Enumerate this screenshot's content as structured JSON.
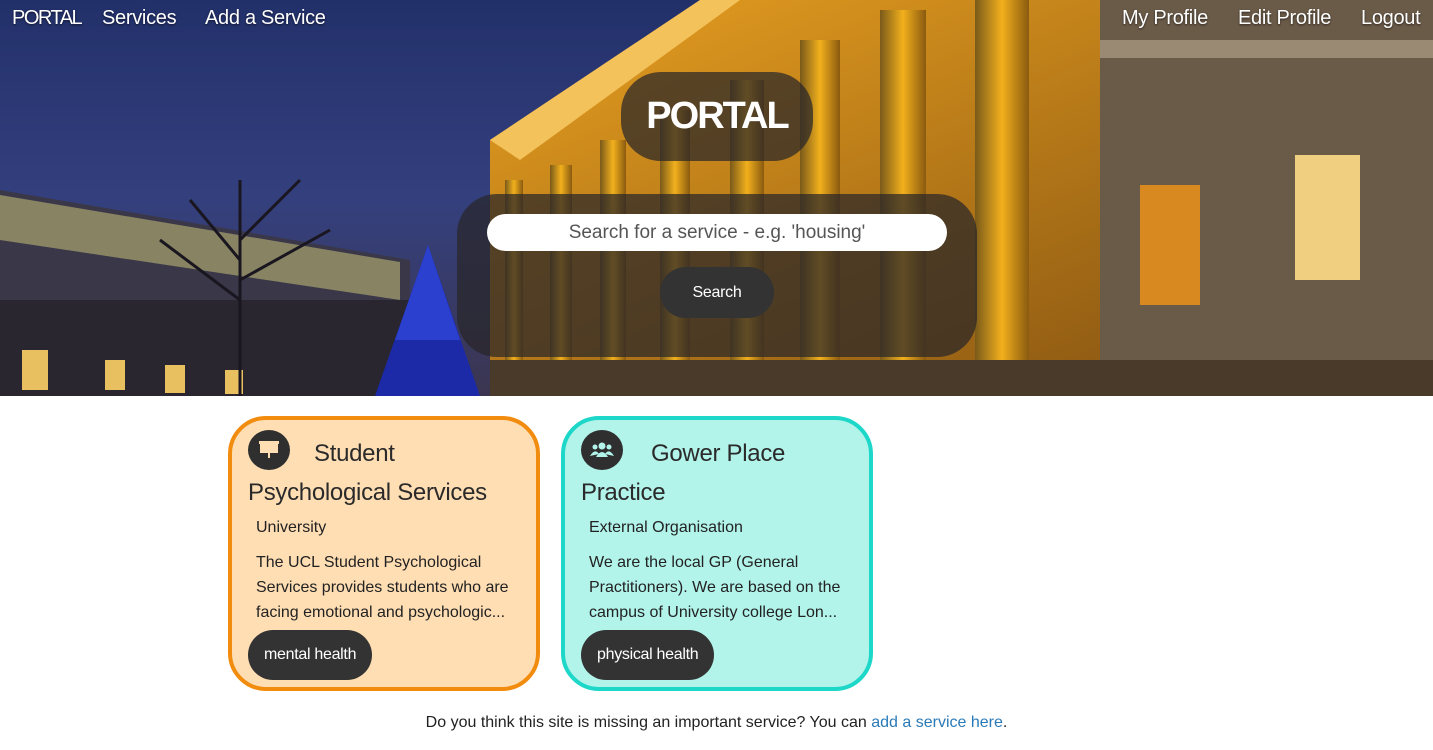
{
  "nav": {
    "brand": "PORTAL",
    "services": "Services",
    "add_service": "Add a Service",
    "my_profile": "My Profile",
    "edit_profile": "Edit Profile",
    "logout": "Logout"
  },
  "hero": {
    "title": "PORTAL",
    "search_placeholder": "Search for a service - e.g. 'housing'",
    "search_button": "Search"
  },
  "cards": [
    {
      "title": "Student Psychological Services",
      "title_line1": "Student",
      "title_line2": "Psychological Services",
      "type": "University",
      "description": "The UCL Student Psychological Services provides students who are facing emotional and psychologic...",
      "tag": "mental health",
      "icon": "presentation-board-icon",
      "background": "#ffdeb4",
      "border": "#f28c0f"
    },
    {
      "title": "Gower Place Practice",
      "title_line1": "Gower Place",
      "title_line2": "Practice",
      "type": "External Organisation",
      "description": "We are the local GP (General Practitioners). We are based on the campus of University college Lon...",
      "tag": "physical health",
      "icon": "group-users-icon",
      "background": "#b2f3ea",
      "border": "#1dd7c8"
    }
  ],
  "footer": {
    "text": "Do you think this site is missing an important service? You can ",
    "link": "add a service here",
    "end": "."
  }
}
